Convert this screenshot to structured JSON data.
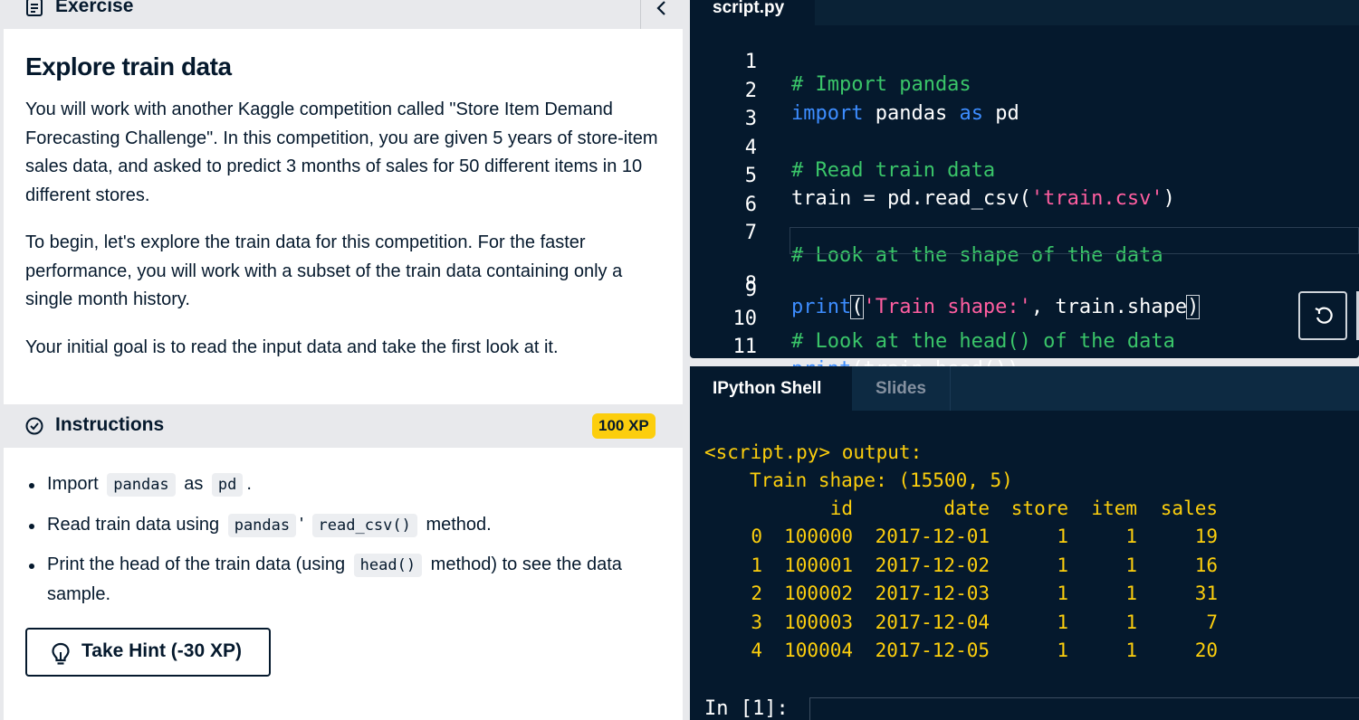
{
  "exercise": {
    "header_title": "Exercise",
    "title": "Explore train data",
    "paragraphs": [
      "You will work with another Kaggle competition called \"Store Item Demand Forecasting Challenge\". In this competition, you are given 5 years of store-item sales data, and asked to predict 3 months of sales for 50 different items in 10 different stores.",
      "To begin, let's explore the train data for this competition. For the faster performance, you will work with a subset of the train data containing only a single month history.",
      "Your initial goal is to read the input data and take the first look at it."
    ]
  },
  "instructions": {
    "label": "Instructions",
    "xp": "100 XP",
    "b1": {
      "t1": "Import",
      "c1": "pandas",
      "t2": "as",
      "c2": "pd",
      "t3": "."
    },
    "b2": {
      "t1": "Read train data using",
      "c1": "pandas",
      "t2": "'",
      "c2": "read_csv()",
      "t3": "method."
    },
    "b3": {
      "t1": "Print the head of the train data (using",
      "c1": "head()",
      "t2": "method) to see the data sample."
    },
    "hint_label": "Take Hint (-30 XP)"
  },
  "editor": {
    "tab": "script.py",
    "line_numbers": [
      "1",
      "2",
      "3",
      "4",
      "5",
      "6",
      "7",
      "8",
      "9",
      "10",
      "11"
    ],
    "code": {
      "l1": "# Import pandas",
      "l2_kw": "import",
      "l2_a": "pandas",
      "l2_as": "as",
      "l2_b": "pd",
      "l4": "# Read train data",
      "l5_a": "train = pd.read_csv(",
      "l5_str": "'train.csv'",
      "l5_b": ")",
      "l7": "# Look at the shape of the data",
      "l8_kw": "print",
      "l8_po": "(",
      "l8_str": "'Train shape:'",
      "l8_mid": ", train.shape",
      "l8_pc": ")",
      "l10": "# Look at the head() of the data",
      "l11_kw": "print",
      "l11_rest": "(train.head())"
    }
  },
  "console": {
    "tabs": [
      "IPython Shell",
      "Slides"
    ],
    "output_header": "<script.py> output:",
    "shape_line": "Train shape: (15500, 5)",
    "columns": [
      "id",
      "date",
      "store",
      "item",
      "sales"
    ],
    "rows": [
      [
        "0",
        "100000",
        "2017-12-01",
        "1",
        "1",
        "19"
      ],
      [
        "1",
        "100001",
        "2017-12-02",
        "1",
        "1",
        "16"
      ],
      [
        "2",
        "100002",
        "2017-12-03",
        "1",
        "1",
        "31"
      ],
      [
        "3",
        "100003",
        "2017-12-04",
        "1",
        "1",
        "7"
      ],
      [
        "4",
        "100004",
        "2017-12-05",
        "1",
        "1",
        "20"
      ]
    ],
    "prompt": "In [1]:"
  }
}
